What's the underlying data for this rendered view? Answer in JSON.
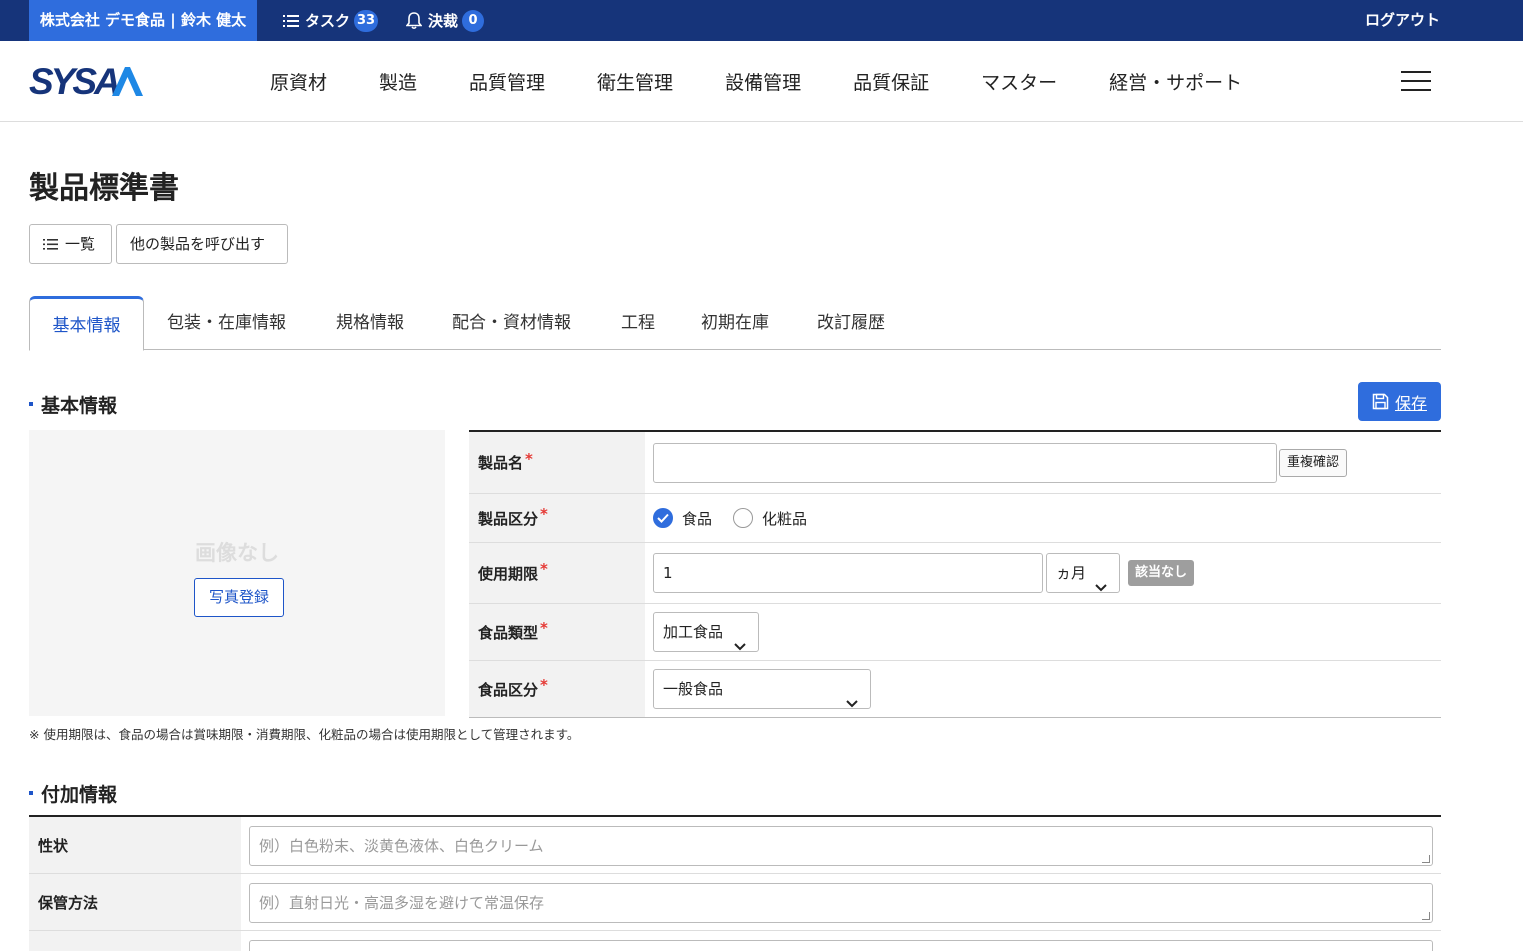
{
  "topbar": {
    "company_user": "株式会社 デモ食品 | 鈴木 健太",
    "task_label": "タスク",
    "task_count": "33",
    "approval_label": "決裁",
    "approval_count": "0",
    "logout": "ログアウト"
  },
  "brand": {
    "logo_text": "SYSA",
    "accent": "#1e88e5",
    "dark": "#16347a"
  },
  "mainnav": [
    "原資材",
    "製造",
    "品質管理",
    "衛生管理",
    "設備管理",
    "品質保証",
    "マスター",
    "経営・サポート"
  ],
  "page": {
    "title": "製品標準書",
    "list_button": "一覧",
    "load_other_button": "他の製品を呼び出す"
  },
  "tabs": [
    "基本情報",
    "包装・在庫情報",
    "規格情報",
    "配合・資材情報",
    "工程",
    "初期在庫",
    "改訂履歴"
  ],
  "basic": {
    "section_title": "基本情報",
    "save_label": "保存",
    "no_image": "画像なし",
    "photo_button": "写真登録",
    "required_mark": "*",
    "fields": {
      "product_name": {
        "label": "製品名",
        "value": "",
        "check_button": "重複確認"
      },
      "product_type": {
        "label": "製品区分",
        "options": [
          "食品",
          "化粧品"
        ],
        "selected": "食品"
      },
      "expiry": {
        "label": "使用期限",
        "value": "1",
        "unit": "ヵ月",
        "badge": "該当なし"
      },
      "food_type": {
        "label": "食品類型",
        "value": "加工食品"
      },
      "food_class": {
        "label": "食品区分",
        "value": "一般食品"
      }
    },
    "note": "※ 使用期限は、食品の場合は賞味期限・消費期限、化粧品の場合は使用期限として管理されます。"
  },
  "extra": {
    "section_title": "付加情報",
    "rows": [
      {
        "label": "性状",
        "placeholder": "例）白色粉末、淡黄色液体、白色クリーム"
      },
      {
        "label": "保管方法",
        "placeholder": "例）直射日光・高温多湿を避けて常温保存"
      }
    ]
  }
}
